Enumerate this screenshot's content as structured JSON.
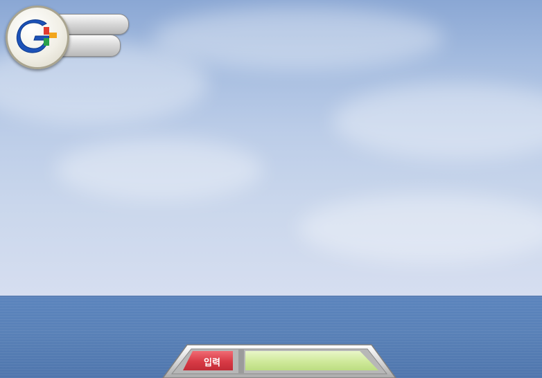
{
  "logo": {
    "icon": "g-plus-logo-icon"
  },
  "input_bar": {
    "button_label": "입력",
    "field_value": ""
  },
  "colors": {
    "sky_top": "#8aa7d4",
    "sea": "#5a82b8",
    "button_red": "#d83a45",
    "field_green": "#cfe99a"
  }
}
